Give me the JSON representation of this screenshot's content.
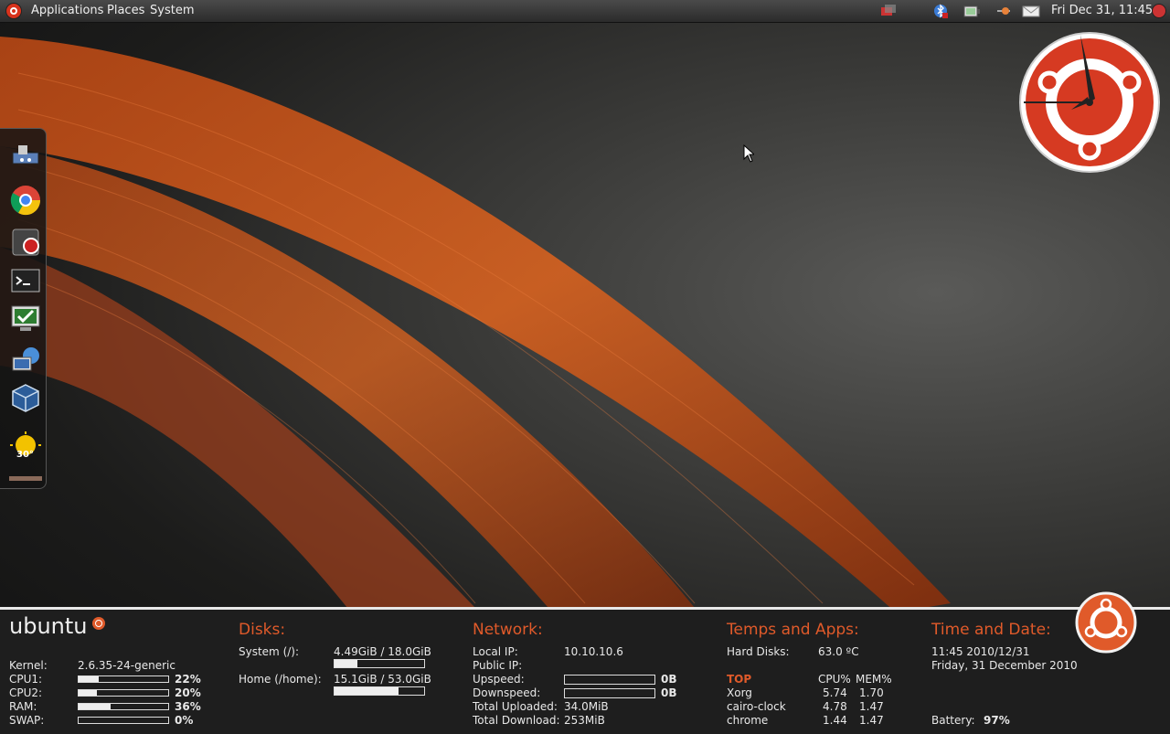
{
  "panel": {
    "menus": [
      "Applications",
      "Places",
      "System"
    ],
    "clock": "Fri Dec 31, 11:45",
    "tray_icons": [
      "network-icon",
      "bluetooth-icon",
      "battery-icon",
      "volume-icon",
      "mail-icon"
    ]
  },
  "dock": {
    "items": [
      "network-manager-icon",
      "chrome-icon",
      "screenshot-icon",
      "terminal-icon",
      "system-monitor-icon",
      "remote-desktop-icon",
      "virtualbox-icon",
      "weather-icon"
    ],
    "weather_temp": "30°"
  },
  "conky": {
    "logo": "ubuntu",
    "system": {
      "rows": [
        {
          "label": "Kernel:",
          "value": "2.6.35-24-generic"
        },
        {
          "label": "CPU1:",
          "value": "22%",
          "level": 0.22
        },
        {
          "label": "CPU2:",
          "value": "20%",
          "level": 0.2
        },
        {
          "label": "RAM:",
          "value": "36%",
          "level": 0.36
        },
        {
          "label": "SWAP:",
          "value": "0%",
          "level": 0.0
        }
      ]
    },
    "disks": {
      "title": "Disks:",
      "rows": [
        {
          "label": "System (/):",
          "value": "4.49GiB / 18.0GiB",
          "level": 0.25
        },
        {
          "label": "Home (/home):",
          "value": "15.1GiB / 53.0GiB",
          "level": 0.71
        }
      ]
    },
    "network": {
      "title": "Network:",
      "rows": [
        {
          "label": "Local IP:",
          "value": "10.10.10.6"
        },
        {
          "label": "Public IP:",
          "value": ""
        },
        {
          "label": "Upspeed:",
          "value": "0B"
        },
        {
          "label": "Downspeed:",
          "value": "0B"
        },
        {
          "label": "Total Uploaded:",
          "value": "34.0MiB"
        },
        {
          "label": "Total Download:",
          "value": "253MiB"
        }
      ]
    },
    "temps": {
      "title": "Temps and Apps:",
      "hard_disks_label": "Hard Disks:",
      "hard_disks_value": "63.0 ºC",
      "top_header": [
        "TOP",
        "CPU%",
        "MEM%"
      ],
      "procs": [
        {
          "name": "Xorg",
          "cpu": "5.74",
          "mem": "1.70"
        },
        {
          "name": "cairo-clock",
          "cpu": "4.78",
          "mem": "1.47"
        },
        {
          "name": "chrome",
          "cpu": "1.44",
          "mem": "1.47"
        }
      ]
    },
    "time": {
      "title": "Time and Date:",
      "line1": "11:45  2010/12/31",
      "line2": "Friday, 31 December 2010",
      "battery_label": "Battery:",
      "battery_value": "97%"
    }
  },
  "colors": {
    "accent": "#e05a2a",
    "panel": "#2b2b2b",
    "conky_bg": "#1e1e1e"
  }
}
